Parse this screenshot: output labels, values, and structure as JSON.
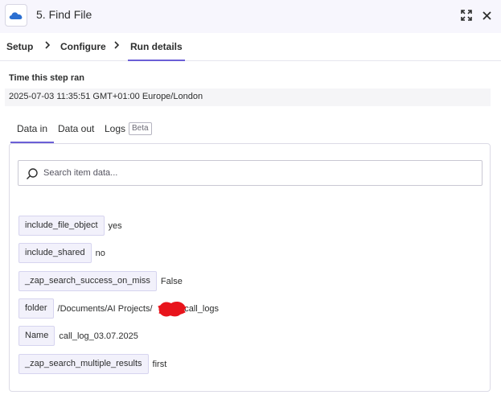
{
  "header": {
    "title": "5. Find File",
    "app_icon": "onedrive-cloud-icon",
    "accent_color": "#2b6fd1"
  },
  "step_nav": {
    "items": [
      {
        "label": "Setup"
      },
      {
        "label": "Configure"
      },
      {
        "label": "Run details",
        "active": true
      }
    ]
  },
  "run": {
    "label": "Time this step ran",
    "value": "2025-07-03 11:35:51 GMT+01:00 Europe/London"
  },
  "tabs": [
    {
      "label": "Data in",
      "active": true
    },
    {
      "label": "Data out"
    },
    {
      "label": "Logs"
    }
  ],
  "logs_badge": "Beta",
  "search": {
    "placeholder": "Search item data..."
  },
  "fields": [
    {
      "key": "include_file_object",
      "value": "yes"
    },
    {
      "key": "include_shared",
      "value": "no"
    },
    {
      "key": "_zap_search_success_on_miss",
      "value": "False"
    },
    {
      "key": "folder",
      "value": "/Documents/AI Projects/            /call_logs",
      "redacted": true
    },
    {
      "key": "Name",
      "value": "call_log_03.07.2025"
    },
    {
      "key": "_zap_search_multiple_results",
      "value": "first"
    }
  ],
  "colors": {
    "accent": "#6b5fd6",
    "header_bg": "#f7f6fd",
    "key_bg": "#f2f1fb",
    "redaction": "#e8141c"
  }
}
